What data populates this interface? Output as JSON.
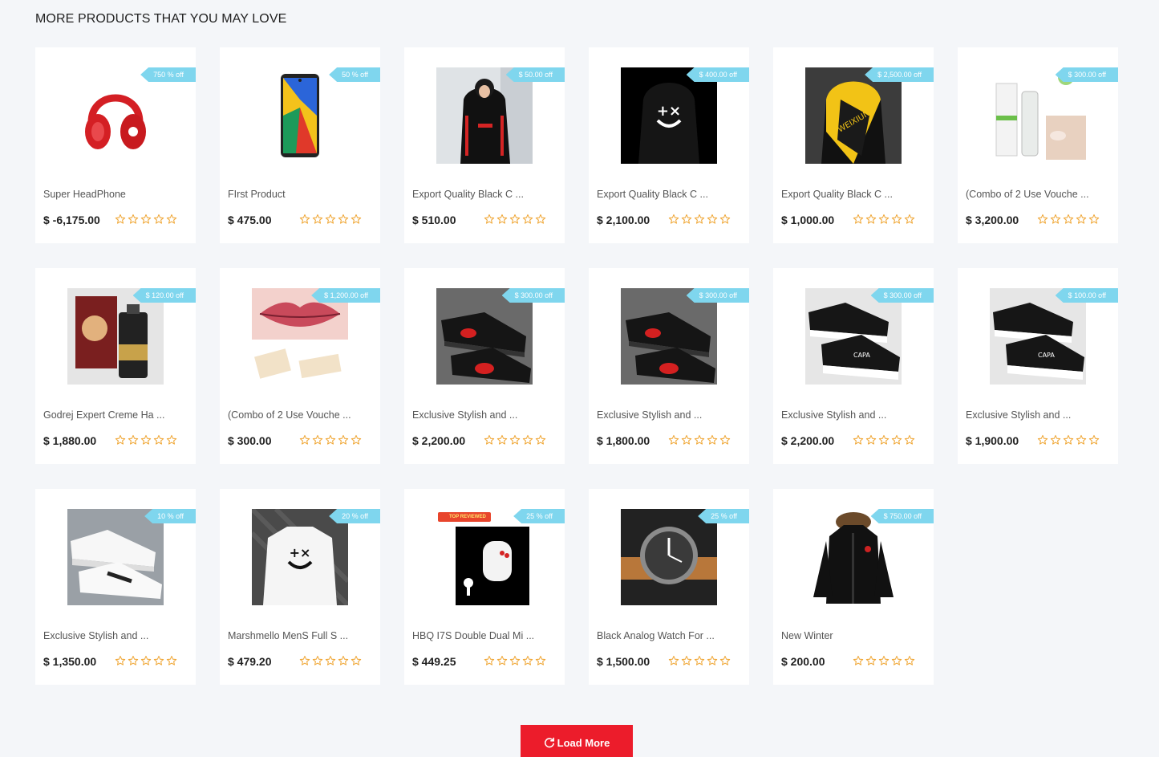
{
  "section": {
    "title": "MORE PRODUCTS THAT YOU MAY LOVE"
  },
  "products": [
    {
      "name": "Super HeadPhone",
      "price": "$ -6,175.00",
      "badge": "750 % off",
      "image": "red-headphones",
      "rating": 0
    },
    {
      "name": "FIrst Product",
      "price": "$ 475.00",
      "badge": "50 % off",
      "image": "smartphone",
      "rating": 0
    },
    {
      "name": "Export Quality Black C ...",
      "price": "$ 510.00",
      "badge": "$ 50.00 off",
      "image": "black-hoodie-person",
      "rating": 0
    },
    {
      "name": "Export Quality Black C ...",
      "price": "$ 2,100.00",
      "badge": "$ 400.00 off",
      "image": "black-hoodie-marshmello",
      "rating": 0
    },
    {
      "name": "Export Quality Black C ...",
      "price": "$ 1,000.00",
      "badge": "$ 2,500.00 off",
      "image": "yellow-black-hoodie",
      "rating": 0
    },
    {
      "name": "(Combo of 2 Use Vouche ...",
      "price": "$ 3,200.00",
      "badge": "$ 300.00 off",
      "image": "cream-tubes",
      "rating": 0
    },
    {
      "name": "Godrej Expert Creme Ha ...",
      "price": "$ 1,880.00",
      "badge": "$ 120.00 off",
      "image": "spray-bottle",
      "rating": 0
    },
    {
      "name": "(Combo of 2 Use Vouche ...",
      "price": "$ 300.00",
      "badge": "$ 1,200.00 off",
      "image": "lips-cosmetic",
      "rating": 0
    },
    {
      "name": "Exclusive Stylish and ...",
      "price": "$ 2,200.00",
      "badge": "$ 300.00 off",
      "image": "black-red-sneakers",
      "rating": 0
    },
    {
      "name": "Exclusive Stylish and ...",
      "price": "$ 1,800.00",
      "badge": "$ 300.00 off",
      "image": "black-red-sneakers",
      "rating": 0
    },
    {
      "name": "Exclusive Stylish and ...",
      "price": "$ 2,200.00",
      "badge": "$ 300.00 off",
      "image": "black-white-sneakers",
      "rating": 0
    },
    {
      "name": "Exclusive Stylish and ...",
      "price": "$ 1,900.00",
      "badge": "$ 100.00 off",
      "image": "black-white-sneakers",
      "rating": 0
    },
    {
      "name": "Exclusive Stylish and ...",
      "price": "$ 1,350.00",
      "badge": "10 % off",
      "image": "white-sneakers",
      "rating": 0
    },
    {
      "name": "Marshmello MenS Full S ...",
      "price": "$ 479.20",
      "badge": "20 % off",
      "image": "white-sweatshirt",
      "rating": 0
    },
    {
      "name": "HBQ I7S Double Dual Mi ...",
      "price": "$ 449.25",
      "badge": "25 % off",
      "image": "earbuds",
      "rating": 0,
      "image_label": "TOP REVIEWED"
    },
    {
      "name": "Black Analog Watch For ...",
      "price": "$ 1,500.00",
      "badge": "25 % off",
      "image": "analog-watch",
      "rating": 0
    },
    {
      "name": "New Winter",
      "price": "$ 200.00",
      "badge": "$ 750.00 off",
      "image": "winter-jacket",
      "rating": 0
    }
  ],
  "load_more": {
    "label": "Load More",
    "icon": "refresh-icon"
  },
  "colors": {
    "badge": "#7fd6ee",
    "star": "#f0a93b",
    "button": "#ec1c2b",
    "background": "#f4f6f9"
  }
}
